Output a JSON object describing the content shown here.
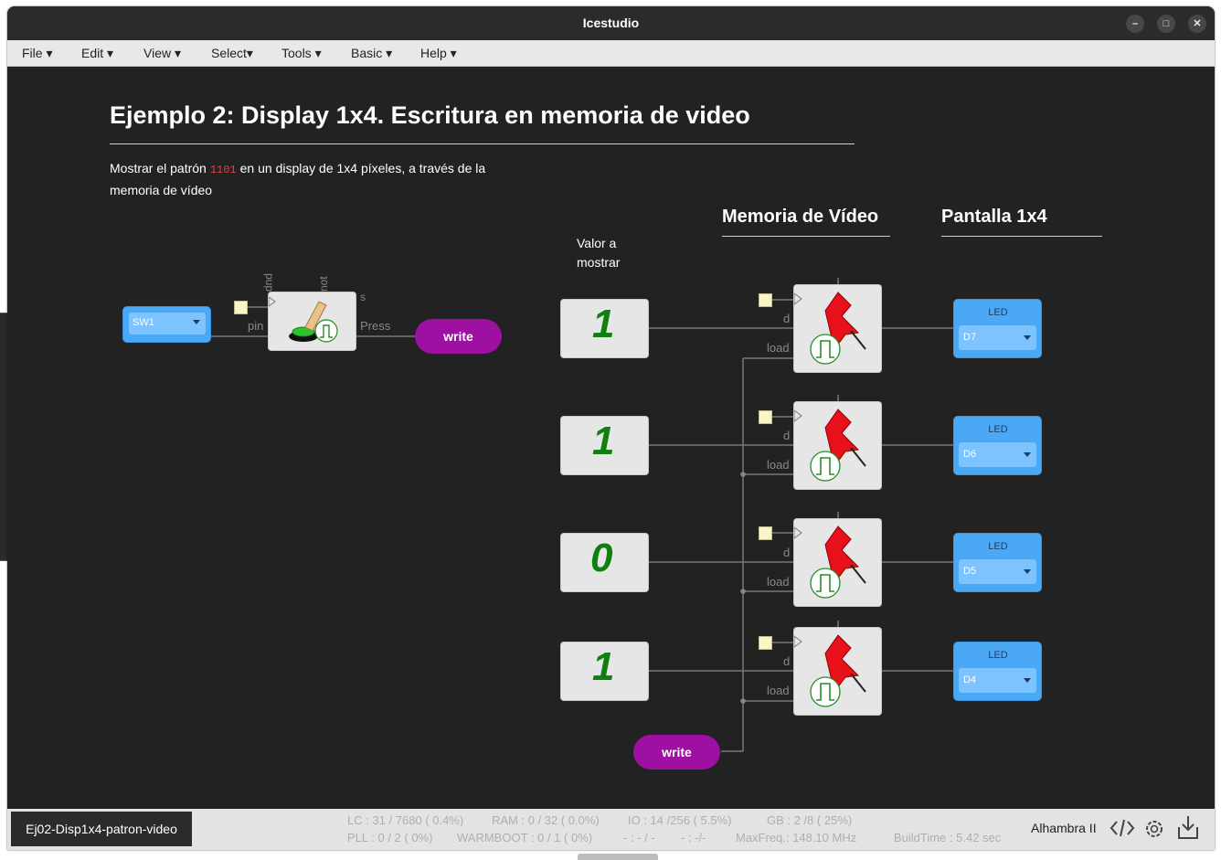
{
  "window": {
    "title": "Icestudio"
  },
  "menu": [
    "File",
    "Edit",
    "View",
    "Select",
    "Tools",
    "Basic",
    "Help"
  ],
  "canvas": {
    "title": "Ejemplo 2: Display 1x4. Escritura en memoria de video",
    "desc_before": "Mostrar el patrón",
    "desc_code": "1101",
    "desc_after": "en un display de 1x4 píxeles, a través de la memoria de vídeo",
    "memoria_heading": "Memoria de Vídeo",
    "pantalla_heading": "Pantalla 1x4",
    "valor_label_1": "Valor a",
    "valor_label_2": "mostrar",
    "sw_pin": "SW1",
    "button_block": {
      "pin_label": "pin",
      "pup_label": "pup",
      "not_label": "not",
      "s_label": "s",
      "press_label": "Press"
    },
    "write_label": "write",
    "write_label_bottom": "write",
    "rows": [
      {
        "digit": "1",
        "d_label": "d",
        "load_label": "load",
        "led_label": "LED",
        "led_pin": "D7"
      },
      {
        "digit": "1",
        "d_label": "d",
        "load_label": "load",
        "led_label": "LED",
        "led_pin": "D6"
      },
      {
        "digit": "0",
        "d_label": "d",
        "load_label": "load",
        "led_label": "LED",
        "led_pin": "D5"
      },
      {
        "digit": "1",
        "d_label": "d",
        "load_label": "load",
        "led_label": "LED",
        "led_pin": "D4"
      }
    ]
  },
  "status": {
    "file_tab": "Ej02-Disp1x4-patron-video",
    "lc": "LC : 31 / 7680 ( 0.4%)",
    "ram": "RAM : 0 / 32 ( 0.0%)",
    "io": "IO :  14 /256  ( 5.5%)",
    "gb": "GB :  2 /8  ( 25%)",
    "pll": "PLL : 0 / 2 ( 0%)",
    "warmboot": "WARMBOOT : 0 / 1 ( 0%)",
    "misc1": "- : - / -",
    "misc2": "- :  -/-",
    "maxfreq": "MaxFreq.:  148.10 MHz",
    "buildtime": "BuildTime :   5.42 sec",
    "board": "Alhambra II"
  },
  "icons": [
    "minimize-icon",
    "maximize-icon",
    "close-icon",
    "code-icon",
    "settings-gear-icon",
    "download-icon",
    "pushbutton-icon",
    "pin-icon",
    "pulse-icon"
  ],
  "colors": {
    "canvas_bg": "#222222",
    "write_tag": "#9d10a2",
    "pin_block": "#4aa8f5",
    "digit_green": "#0f7f0f",
    "pin_red": "#e8101a"
  }
}
